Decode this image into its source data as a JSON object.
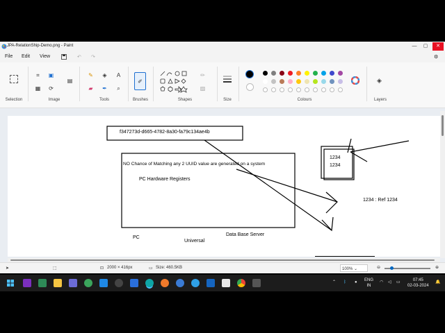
{
  "window": {
    "title": "JPA-RelationShip-Demo.png - Paint",
    "minimize_glyph": "—",
    "maximize_glyph": "▢",
    "close_glyph": "✕"
  },
  "menu": {
    "file": "File",
    "edit": "Edit",
    "view": "View"
  },
  "ribbon": {
    "groups": {
      "selection": "Selection",
      "image": "Image",
      "tools": "Tools",
      "brushes": "Brushes",
      "shapes": "Shapes",
      "size": "Size",
      "colours": "Colours",
      "layers": "Layers"
    },
    "colors_row1": [
      "#000000",
      "#7f7f7f",
      "#880015",
      "#ed1c24",
      "#ff7f27",
      "#fff200",
      "#22b14c",
      "#00a2e8",
      "#3f48cc",
      "#a349a4"
    ],
    "colors_row2": [
      "#ffffff",
      "#c3c3c3",
      "#b97a57",
      "#ffaec9",
      "#ffc90e",
      "#efe4b0",
      "#b5e61d",
      "#99d9ea",
      "#7092be",
      "#c8bfe7"
    ],
    "primary_color": "#000000",
    "secondary_color": "#ffffff"
  },
  "canvas": {
    "uuid_text": "f347273d-d665-4782-8a30-fa79c134ae4b",
    "statement": "NO Chance of Matching any 2 UUID value are generated on a system",
    "hardware_text": "PC Hardware Registers",
    "pc_label": "PC",
    "universal_label": "Universal",
    "db_server_label": "Data Base Server",
    "small_box_line1": "1234",
    "small_box_line2": "1234",
    "ref_label": "1234 : Ref 1234"
  },
  "status": {
    "dimensions": "2000 × 416px",
    "size": "Size: 460.5KB",
    "zoom": "100%"
  },
  "tray": {
    "lang_line1": "ENG",
    "lang_line2": "IN",
    "time": "07:45",
    "date": "02-03-2024"
  },
  "colors": {
    "accent": "#0067c0",
    "close_red": "#e81123",
    "taskbar_bg": "#1c1c1c"
  }
}
